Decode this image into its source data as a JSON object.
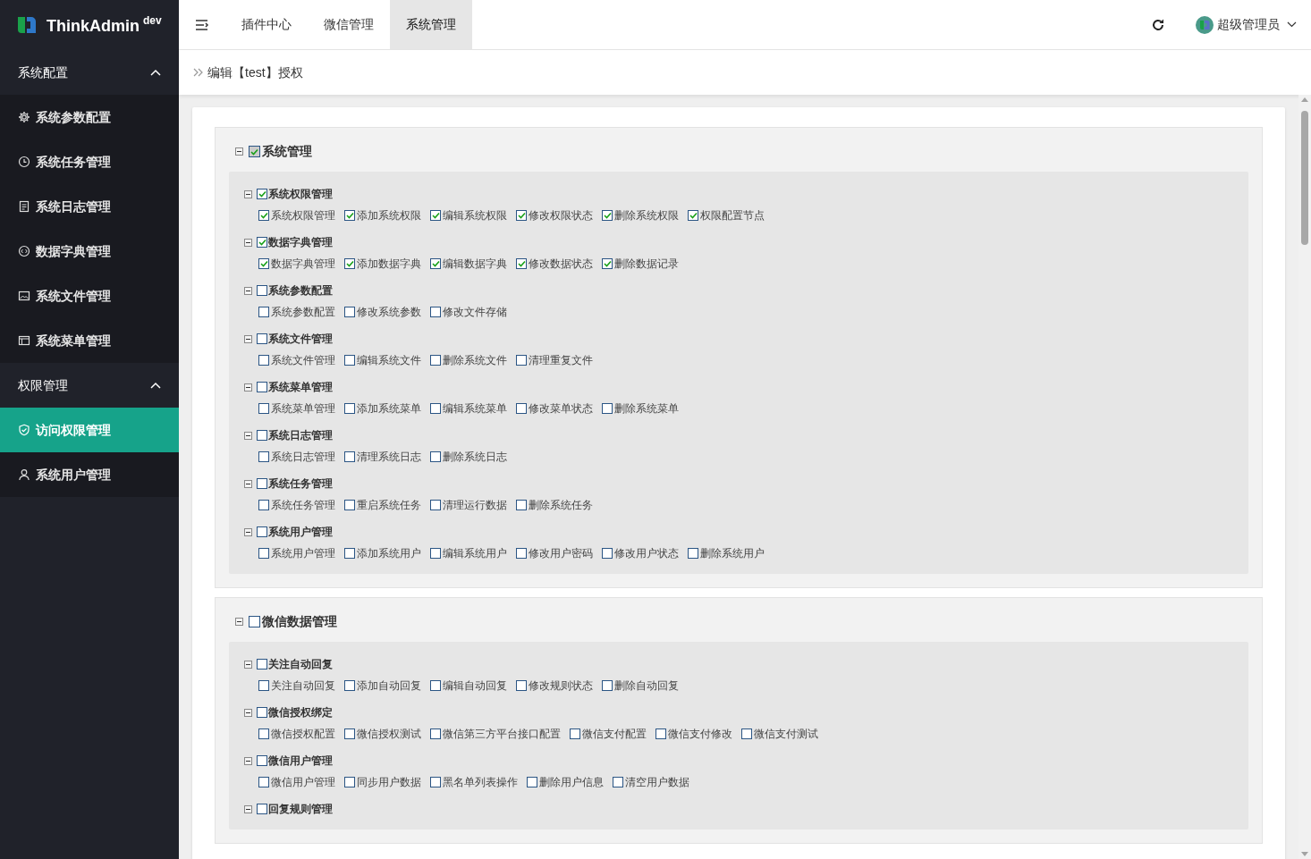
{
  "sidebar": {
    "brand": {
      "name": "ThinkAdmin",
      "tag": "dev"
    },
    "groups": [
      {
        "label": "系统配置",
        "expanded": true,
        "items": [
          {
            "label": "系统参数配置",
            "selected": false
          },
          {
            "label": "系统任务管理",
            "selected": false
          },
          {
            "label": "系统日志管理",
            "selected": false
          },
          {
            "label": "数据字典管理",
            "selected": false
          },
          {
            "label": "系统文件管理",
            "selected": false
          },
          {
            "label": "系统菜单管理",
            "selected": false
          }
        ]
      },
      {
        "label": "权限管理",
        "expanded": true,
        "items": [
          {
            "label": "访问权限管理",
            "selected": true
          },
          {
            "label": "系统用户管理",
            "selected": false
          }
        ]
      }
    ]
  },
  "topbar": {
    "tabs": [
      {
        "label": "插件中心",
        "selected": false
      },
      {
        "label": "微信管理",
        "selected": false
      },
      {
        "label": "系统管理",
        "selected": true
      }
    ],
    "user": "超级管理员"
  },
  "breadcrumb": "编辑【test】授权",
  "tree": [
    {
      "label": "系统管理",
      "checked": true,
      "expanded": true,
      "children": [
        {
          "label": "系统权限管理",
          "checked": true,
          "expanded": true,
          "children": [
            {
              "label": "系统权限管理",
              "checked": true
            },
            {
              "label": "添加系统权限",
              "checked": true
            },
            {
              "label": "编辑系统权限",
              "checked": true
            },
            {
              "label": "修改权限状态",
              "checked": true
            },
            {
              "label": "删除系统权限",
              "checked": true
            },
            {
              "label": "权限配置节点",
              "checked": true
            }
          ]
        },
        {
          "label": "数据字典管理",
          "checked": true,
          "expanded": true,
          "children": [
            {
              "label": "数据字典管理",
              "checked": true
            },
            {
              "label": "添加数据字典",
              "checked": true
            },
            {
              "label": "编辑数据字典",
              "checked": true
            },
            {
              "label": "修改数据状态",
              "checked": true
            },
            {
              "label": "删除数据记录",
              "checked": true
            }
          ]
        },
        {
          "label": "系统参数配置",
          "checked": false,
          "expanded": true,
          "children": [
            {
              "label": "系统参数配置",
              "checked": false
            },
            {
              "label": "修改系统参数",
              "checked": false
            },
            {
              "label": "修改文件存储",
              "checked": false
            }
          ]
        },
        {
          "label": "系统文件管理",
          "checked": false,
          "expanded": true,
          "children": [
            {
              "label": "系统文件管理",
              "checked": false
            },
            {
              "label": "编辑系统文件",
              "checked": false
            },
            {
              "label": "删除系统文件",
              "checked": false
            },
            {
              "label": "清理重复文件",
              "checked": false
            }
          ]
        },
        {
          "label": "系统菜单管理",
          "checked": false,
          "expanded": true,
          "children": [
            {
              "label": "系统菜单管理",
              "checked": false
            },
            {
              "label": "添加系统菜单",
              "checked": false
            },
            {
              "label": "编辑系统菜单",
              "checked": false
            },
            {
              "label": "修改菜单状态",
              "checked": false
            },
            {
              "label": "删除系统菜单",
              "checked": false
            }
          ]
        },
        {
          "label": "系统日志管理",
          "checked": false,
          "expanded": true,
          "children": [
            {
              "label": "系统日志管理",
              "checked": false
            },
            {
              "label": "清理系统日志",
              "checked": false
            },
            {
              "label": "删除系统日志",
              "checked": false
            }
          ]
        },
        {
          "label": "系统任务管理",
          "checked": false,
          "expanded": true,
          "children": [
            {
              "label": "系统任务管理",
              "checked": false
            },
            {
              "label": "重启系统任务",
              "checked": false
            },
            {
              "label": "清理运行数据",
              "checked": false
            },
            {
              "label": "删除系统任务",
              "checked": false
            }
          ]
        },
        {
          "label": "系统用户管理",
          "checked": false,
          "expanded": true,
          "children": [
            {
              "label": "系统用户管理",
              "checked": false
            },
            {
              "label": "添加系统用户",
              "checked": false
            },
            {
              "label": "编辑系统用户",
              "checked": false
            },
            {
              "label": "修改用户密码",
              "checked": false
            },
            {
              "label": "修改用户状态",
              "checked": false
            },
            {
              "label": "删除系统用户",
              "checked": false
            }
          ]
        }
      ]
    },
    {
      "label": "微信数据管理",
      "checked": false,
      "expanded": true,
      "children": [
        {
          "label": "关注自动回复",
          "checked": false,
          "expanded": true,
          "children": [
            {
              "label": "关注自动回复",
              "checked": false
            },
            {
              "label": "添加自动回复",
              "checked": false
            },
            {
              "label": "编辑自动回复",
              "checked": false
            },
            {
              "label": "修改规则状态",
              "checked": false
            },
            {
              "label": "删除自动回复",
              "checked": false
            }
          ]
        },
        {
          "label": "微信授权绑定",
          "checked": false,
          "expanded": true,
          "children": [
            {
              "label": "微信授权配置",
              "checked": false
            },
            {
              "label": "微信授权测试",
              "checked": false
            },
            {
              "label": "微信第三方平台接口配置",
              "checked": false
            },
            {
              "label": "微信支付配置",
              "checked": false
            },
            {
              "label": "微信支付修改",
              "checked": false
            },
            {
              "label": "微信支付测试",
              "checked": false
            }
          ]
        },
        {
          "label": "微信用户管理",
          "checked": false,
          "expanded": true,
          "children": [
            {
              "label": "微信用户管理",
              "checked": false
            },
            {
              "label": "同步用户数据",
              "checked": false
            },
            {
              "label": "黑名单列表操作",
              "checked": false
            },
            {
              "label": "删除用户信息",
              "checked": false
            },
            {
              "label": "清空用户数据",
              "checked": false
            }
          ]
        },
        {
          "label": "回复规则管理",
          "checked": false,
          "expanded": true
        }
      ]
    }
  ]
}
